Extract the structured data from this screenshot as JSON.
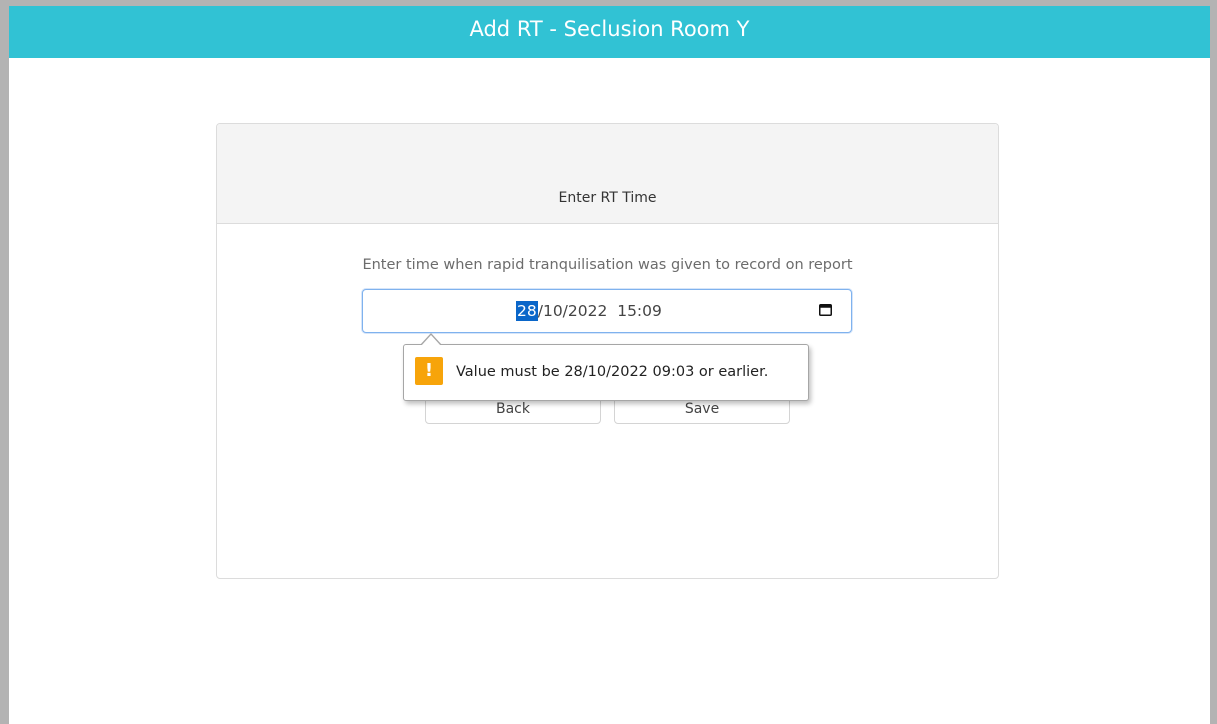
{
  "window": {
    "title": "Add RT - Seclusion Room Y"
  },
  "card": {
    "header": "Enter RT Time",
    "instruction": "Enter time when rapid tranquilisation was given to record on report",
    "date_input": {
      "day_selected": "28",
      "rest": "/10/2022  15:09",
      "icon": "calendar-icon"
    },
    "buttons": {
      "back": "Back",
      "save": "Save"
    }
  },
  "validation": {
    "icon": "warning-icon",
    "message": "Value must be 28/10/2022 09:03 or earlier.",
    "icon_color": "#f7a40a"
  },
  "colors": {
    "titlebar": "#31c2d4",
    "selection": "#0a66c9"
  }
}
